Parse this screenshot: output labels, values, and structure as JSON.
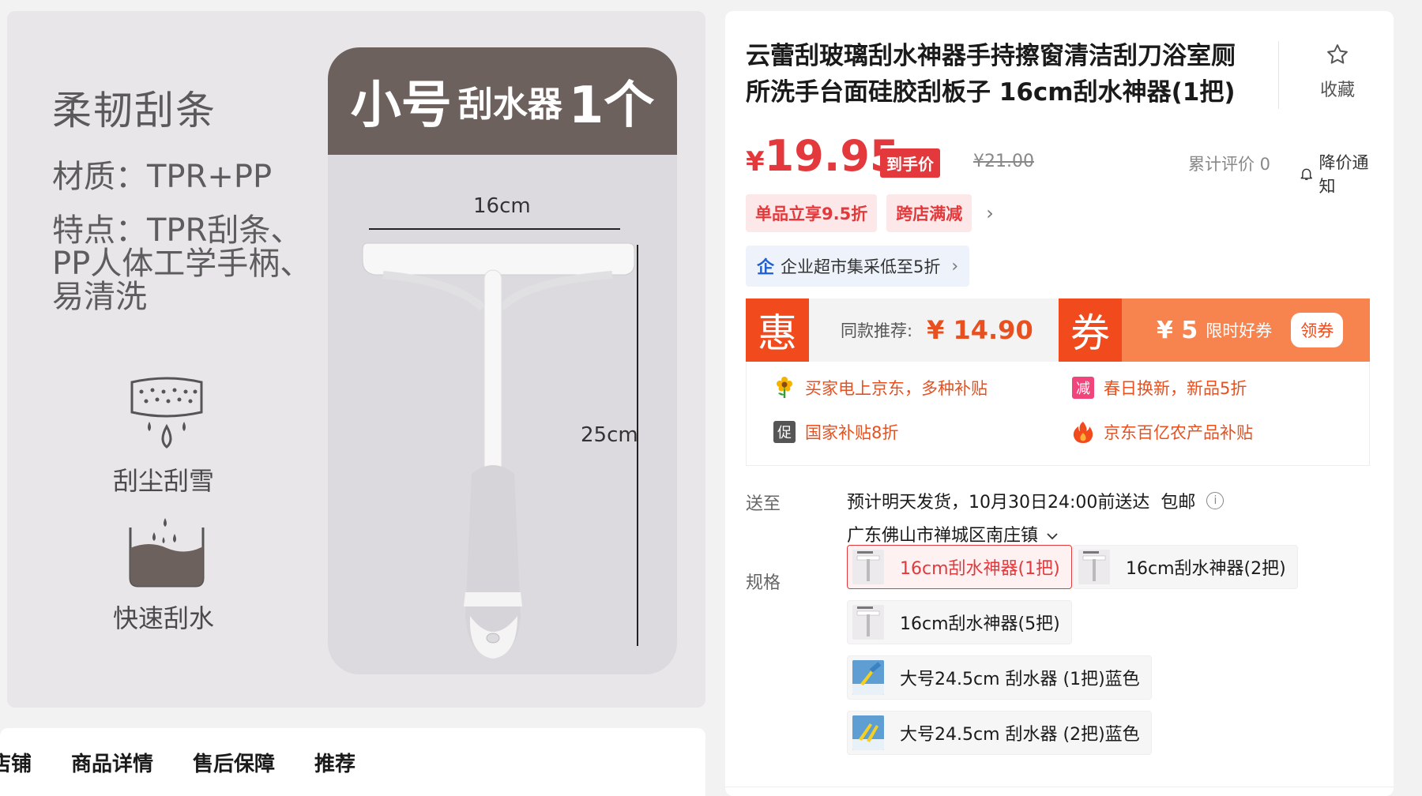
{
  "image_panel": {
    "title": "柔韧刮条",
    "material": "材质：TPR+PP",
    "features": [
      "特点：TPR刮条、",
      "PP人体工学手柄、",
      "易清洗"
    ],
    "feature1_caption": "刮尘刮雪",
    "feature2_caption": "快速刮水",
    "size_card": {
      "head_part1": "小号",
      "head_part2": "刮水器",
      "head_part3": "1个",
      "width_label": "16cm",
      "height_label": "25cm"
    },
    "colors": {
      "card_head": "#6d615e",
      "background": "#e8e6e9"
    }
  },
  "tabs": [
    "店铺",
    "商品详情",
    "售后保障",
    "推荐"
  ],
  "product": {
    "title": "云蕾刮玻璃刮水神器手持擦窗清洁刮刀浴室厕所洗手台面硅胶刮板子 16cm刮水神器(1把)",
    "favorite_label": "收藏",
    "price_symbol": "¥",
    "price": "19.95",
    "price_tag": "到手价",
    "original_price": "¥21.00",
    "review_text": "累计评价 0",
    "notify_label": "降价通知",
    "promo_tags": [
      "单品立享9.5折",
      "跨店满减"
    ],
    "enterprise": {
      "icon": "企",
      "text": "企业超市集采低至5折"
    },
    "deal": {
      "hui_label": "惠",
      "rec_label": "同款推荐:",
      "rec_price": "¥ 14.90",
      "quan_label": "券",
      "coupon_amount": "¥ 5",
      "coupon_desc": "限时好券",
      "coupon_button": "领券"
    },
    "benefits": [
      {
        "icon": "flower-icon",
        "text": "买家电上京东，多种补贴"
      },
      {
        "icon": "jian-icon",
        "icon_text": "减",
        "text": "春日换新，新品5折"
      },
      {
        "icon": "cu-icon",
        "icon_text": "促",
        "text": "国家补贴8折"
      },
      {
        "icon": "fire-icon",
        "text": "京东百亿农产品补贴"
      }
    ],
    "shipping": {
      "label": "送至",
      "text": "预计明天发货，10月30日24:00前送达",
      "free": "包邮",
      "info_icon": "i",
      "address": "广东佛山市禅城区南庄镇"
    },
    "specs": {
      "label": "规格",
      "options": [
        {
          "text": "16cm刮水神器(1把)",
          "selected": true
        },
        {
          "text": "16cm刮水神器(2把)",
          "selected": false
        },
        {
          "text": "16cm刮水神器(5把)",
          "selected": false
        },
        {
          "text": "大号24.5cm 刮水器 (1把)蓝色",
          "selected": false
        },
        {
          "text": "大号24.5cm 刮水器 (2把)蓝色",
          "selected": false
        }
      ]
    },
    "colors": {
      "accent_red": "#e4393c",
      "coupon_orange": "#f7834f",
      "hui_orange": "#f04a1d"
    }
  }
}
